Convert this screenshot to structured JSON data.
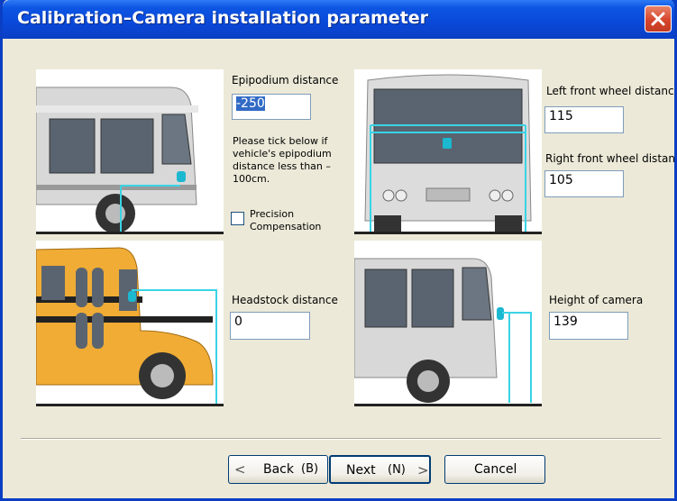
{
  "window": {
    "title": "Calibration–Camera installation parameter"
  },
  "epipodium": {
    "label": "Epipodium distance",
    "value": "-250",
    "note": "Please tick below if vehicle's epipodium distance less than –100cm.",
    "checkbox_label": "Precision Compensation",
    "checked": false
  },
  "headstock": {
    "label": "Headstock distance",
    "value": "0"
  },
  "left_wheel": {
    "label": "Left front wheel distance",
    "value": "115"
  },
  "right_wheel": {
    "label": "Right front wheel distance",
    "value": "105"
  },
  "camera_height": {
    "label": "Height of camera",
    "value": "139"
  },
  "buttons": {
    "back_label": "Back",
    "back_accel": "(B)",
    "next_label": "Next",
    "next_accel": "(N)",
    "cancel_label": "Cancel",
    "back_chevron": "<",
    "next_chevron": ">"
  },
  "colors": {
    "guide_line": "#3ad3e6",
    "window_frame": "#0a3fc4",
    "dialog_bg": "#ece9d8"
  },
  "icons": [
    "close-icon",
    "camera-icon",
    "checkbox-icon"
  ]
}
